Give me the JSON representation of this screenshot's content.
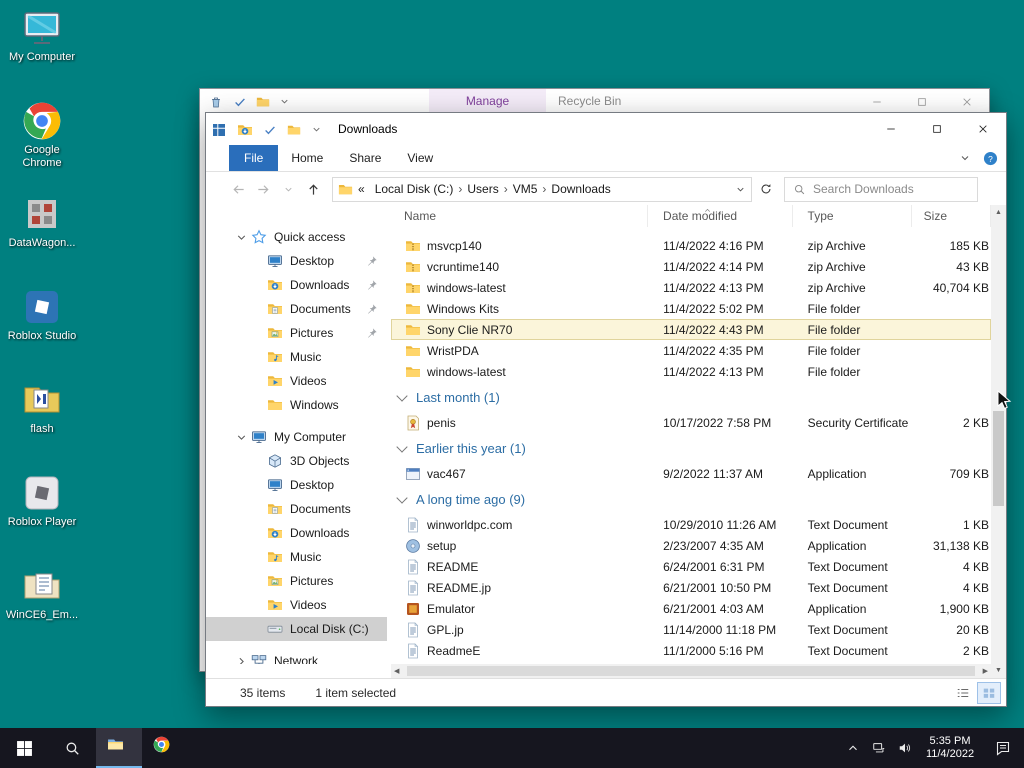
{
  "colors": {
    "desktop_background": "#008080",
    "taskbar_background": "#16161f",
    "accent_blue": "#0078d7",
    "file_tab_blue": "#2a6ebb",
    "manage_tab_purple": "#80409c",
    "group_header_blue": "#2c6da4",
    "selected_row_cream": "#fbf5da",
    "sidebar_selected_gray": "#d0d0d0"
  },
  "desktop": {
    "icons": [
      {
        "label": "My Computer",
        "icon": "computer-desktop-icon"
      },
      {
        "label": "Google Chrome",
        "icon": "chrome-icon"
      },
      {
        "label": "DataWagon...",
        "icon": "datawagon-icon"
      },
      {
        "label": "Roblox Studio",
        "icon": "roblox-studio-icon"
      },
      {
        "label": "flash",
        "icon": "flash-icon"
      },
      {
        "label": "Roblox Player",
        "icon": "roblox-player-icon"
      },
      {
        "label": "WinCE6_Em...",
        "icon": "wince-icon"
      }
    ]
  },
  "recycle_window": {
    "manage_tab": "Manage",
    "title": "Recycle Bin",
    "window_buttons": [
      "minimize",
      "maximize",
      "close"
    ]
  },
  "explorer": {
    "title": "Downloads",
    "window_buttons": [
      "minimize",
      "maximize",
      "close"
    ],
    "ribbon": {
      "tabs": [
        "File",
        "Home",
        "Share",
        "View"
      ],
      "help": "?"
    },
    "address": {
      "prefix": "«",
      "segments": [
        "Local Disk (C:)",
        "Users",
        "VM5",
        "Downloads"
      ]
    },
    "search": {
      "placeholder": "Search Downloads"
    },
    "sidebar": {
      "sections": [
        {
          "label": "Quick access",
          "icon": "star-icon",
          "expanded": true,
          "items": [
            {
              "label": "Desktop",
              "icon": "monitor-icon",
              "pinned": true
            },
            {
              "label": "Downloads",
              "icon": "downloads-icon",
              "pinned": true
            },
            {
              "label": "Documents",
              "icon": "documents-icon",
              "pinned": true
            },
            {
              "label": "Pictures",
              "icon": "pictures-icon",
              "pinned": true
            },
            {
              "label": "Music",
              "icon": "music-icon"
            },
            {
              "label": "Videos",
              "icon": "videos-icon"
            },
            {
              "label": "Windows",
              "icon": "folder-icon"
            }
          ]
        },
        {
          "label": "My Computer",
          "icon": "monitor-icon",
          "expanded": true,
          "items": [
            {
              "label": "3D Objects",
              "icon": "cube-icon"
            },
            {
              "label": "Desktop",
              "icon": "monitor-icon"
            },
            {
              "label": "Documents",
              "icon": "documents-icon"
            },
            {
              "label": "Downloads",
              "icon": "downloads-icon"
            },
            {
              "label": "Music",
              "icon": "music-icon"
            },
            {
              "label": "Pictures",
              "icon": "pictures-icon"
            },
            {
              "label": "Videos",
              "icon": "videos-icon"
            },
            {
              "label": "Local Disk (C:)",
              "icon": "disk-icon",
              "selected": true
            }
          ]
        },
        {
          "label": "Network",
          "icon": "network-icon",
          "expanded": false,
          "items": []
        }
      ]
    },
    "list": {
      "columns": [
        "Name",
        "Date modified",
        "Type",
        "Size"
      ],
      "sort_column": "Date modified",
      "rows": [
        {
          "kind": "file",
          "icon": "zip-icon",
          "name": "msvcp140",
          "date": "11/4/2022 4:16 PM",
          "type": "zip Archive",
          "size": "185 KB"
        },
        {
          "kind": "file",
          "icon": "zip-icon",
          "name": "vcruntime140",
          "date": "11/4/2022 4:14 PM",
          "type": "zip Archive",
          "size": "43 KB"
        },
        {
          "kind": "file",
          "icon": "zip-icon",
          "name": "windows-latest",
          "date": "11/4/2022 4:13 PM",
          "type": "zip Archive",
          "size": "40,704 KB"
        },
        {
          "kind": "file",
          "icon": "folder-icon",
          "name": "Windows Kits",
          "date": "11/4/2022 5:02 PM",
          "type": "File folder",
          "size": ""
        },
        {
          "kind": "file",
          "icon": "folder-icon",
          "name": "Sony Clie NR70",
          "date": "11/4/2022 4:43 PM",
          "type": "File folder",
          "size": "",
          "selected": true
        },
        {
          "kind": "file",
          "icon": "folder-icon",
          "name": "WristPDA",
          "date": "11/4/2022 4:35 PM",
          "type": "File folder",
          "size": ""
        },
        {
          "kind": "file",
          "icon": "folder-icon",
          "name": "windows-latest",
          "date": "11/4/2022 4:13 PM",
          "type": "File folder",
          "size": ""
        },
        {
          "kind": "group",
          "label": "Last month (1)"
        },
        {
          "kind": "file",
          "icon": "certificate-icon",
          "name": "penis",
          "date": "10/17/2022 7:58 PM",
          "type": "Security Certificate",
          "size": "2 KB"
        },
        {
          "kind": "group",
          "label": "Earlier this year (1)"
        },
        {
          "kind": "file",
          "icon": "app-icon",
          "name": "vac467",
          "date": "9/2/2022 11:37 AM",
          "type": "Application",
          "size": "709 KB"
        },
        {
          "kind": "group",
          "label": "A long time ago (9)"
        },
        {
          "kind": "file",
          "icon": "text-icon",
          "name": "winworldpc.com",
          "date": "10/29/2010 11:26 AM",
          "type": "Text Document",
          "size": "1 KB"
        },
        {
          "kind": "file",
          "icon": "setup-icon",
          "name": "setup",
          "date": "2/23/2007 4:35 AM",
          "type": "Application",
          "size": "31,138 KB"
        },
        {
          "kind": "file",
          "icon": "text-icon",
          "name": "README",
          "date": "6/24/2001 6:31 PM",
          "type": "Text Document",
          "size": "4 KB"
        },
        {
          "kind": "file",
          "icon": "text-icon",
          "name": "README.jp",
          "date": "6/21/2001 10:50 PM",
          "type": "Text Document",
          "size": "4 KB"
        },
        {
          "kind": "file",
          "icon": "emulator-icon",
          "name": "Emulator",
          "date": "6/21/2001 4:03 AM",
          "type": "Application",
          "size": "1,900 KB"
        },
        {
          "kind": "file",
          "icon": "text-icon",
          "name": "GPL.jp",
          "date": "11/14/2000 11:18 PM",
          "type": "Text Document",
          "size": "20 KB"
        },
        {
          "kind": "file",
          "icon": "text-icon",
          "name": "ReadmeE",
          "date": "11/1/2000 5:16 PM",
          "type": "Text Document",
          "size": "2 KB"
        }
      ]
    },
    "status": {
      "items": "35 items",
      "selected": "1 item selected"
    }
  },
  "taskbar": {
    "start_icon": "windows-logo-icon",
    "search_icon": "search-icon",
    "apps": [
      {
        "label": "File Explorer",
        "icon": "explorer-tb-icon",
        "active": true
      },
      {
        "label": "Google Chrome",
        "icon": "chrome-icon",
        "active": false
      }
    ],
    "tray": {
      "icons": [
        "chevron-up-icon",
        "ethernet-icon",
        "speaker-icon"
      ],
      "action_center": "action-center-icon"
    },
    "clock": {
      "time": "5:35 PM",
      "date": "11/4/2022"
    }
  }
}
